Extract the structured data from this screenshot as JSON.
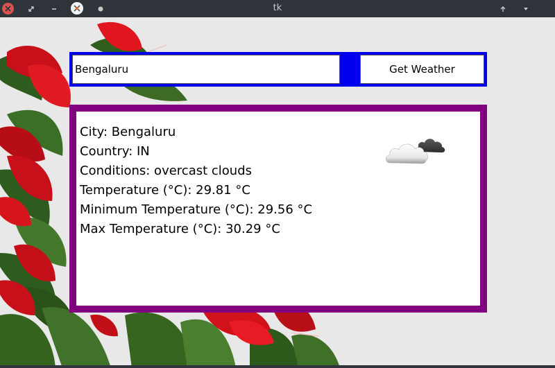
{
  "window": {
    "title": "tk"
  },
  "titlebar": {
    "icons": [
      "close-icon",
      "restore-icon",
      "minimize-icon",
      "app-icon",
      "sticky-icon",
      "shade-up-icon",
      "shade-down-icon"
    ]
  },
  "search": {
    "city_value": "Bengaluru",
    "button_label": "Get Weather"
  },
  "result": {
    "lines": [
      "City: Bengaluru",
      "Country: IN",
      "Conditions: overcast clouds",
      "Temperature (°C): 29.81 °C",
      "Minimum Temperature (°C): 29.56 °C",
      "Max Temperature (°C): 30.29 °C"
    ],
    "icon": "overcast-clouds-icon"
  },
  "colors": {
    "search_frame": "#0000ee",
    "result_frame": "#800080",
    "window_bg": "#e8e8e8",
    "titlebar_bg": "#2f343b"
  }
}
